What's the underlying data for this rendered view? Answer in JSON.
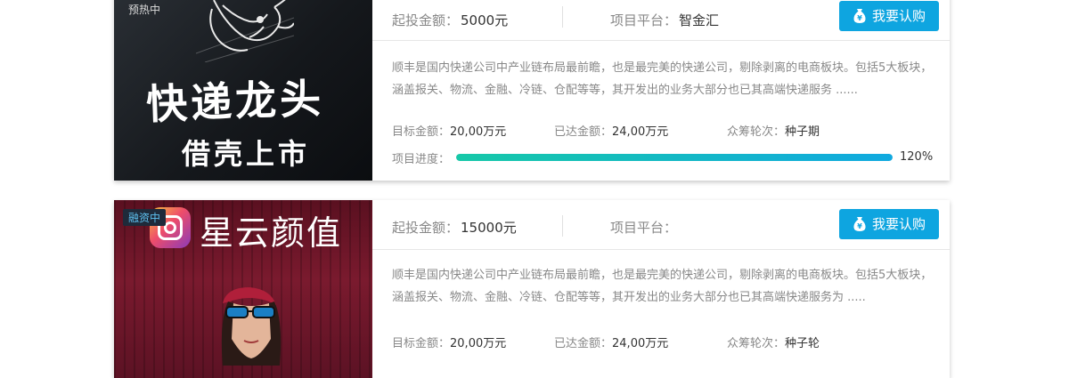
{
  "projects": [
    {
      "badge": "预热中",
      "image_title": "快递龙头",
      "image_subtitle": "借壳上市",
      "amount_label": "起投金额：",
      "amount_value": "5000元",
      "platform_label": "项目平台：",
      "platform_value": "智金汇",
      "buy_label": "我要认购",
      "description": "顺丰是国内快递公司中产业链布局最前瞻，也是最完美的快递公司，剔除剥离的电商板块。包括5大板块，涵盖报关、物流、金融、冷链、仓配等等，其开发出的业务大部分也已其高端快递服务 ......",
      "target_label": "目标金额：",
      "target_value": "20,00万元",
      "reached_label": "已达金额：",
      "reached_value": "24,00万元",
      "round_label": "众筹轮次：",
      "round_value": "种子期",
      "progress_label": "项目进度：",
      "progress_text": "120%",
      "progress_fraction": 1.0
    },
    {
      "badge": "融资中",
      "image_title": "星云颜值",
      "amount_label": "起投金额：",
      "amount_value": "15000元",
      "platform_label": "项目平台：",
      "platform_value": "",
      "buy_label": "我要认购",
      "description": "顺丰是国内快递公司中产业链布局最前瞻，也是最完美的快递公司，剔除剥离的电商板块。包括5大板块，涵盖报关、物流、金融、冷链、仓配等等，其开发出的业务大部分也已其高端快递服务为 .....",
      "target_label": "目标金额：",
      "target_value": "20,00万元",
      "reached_label": "已达金额：",
      "reached_value": "24,00万元",
      "round_label": "众筹轮次：",
      "round_value": "种子轮"
    }
  ],
  "icons": {
    "buy": "money-bag-icon",
    "dragon": "dragon-icon",
    "app_logo": "app-logo-icon"
  },
  "colors": {
    "accent": "#0ea5e0",
    "progress_start": "#16c8a8",
    "progress_end": "#10a9e0"
  }
}
